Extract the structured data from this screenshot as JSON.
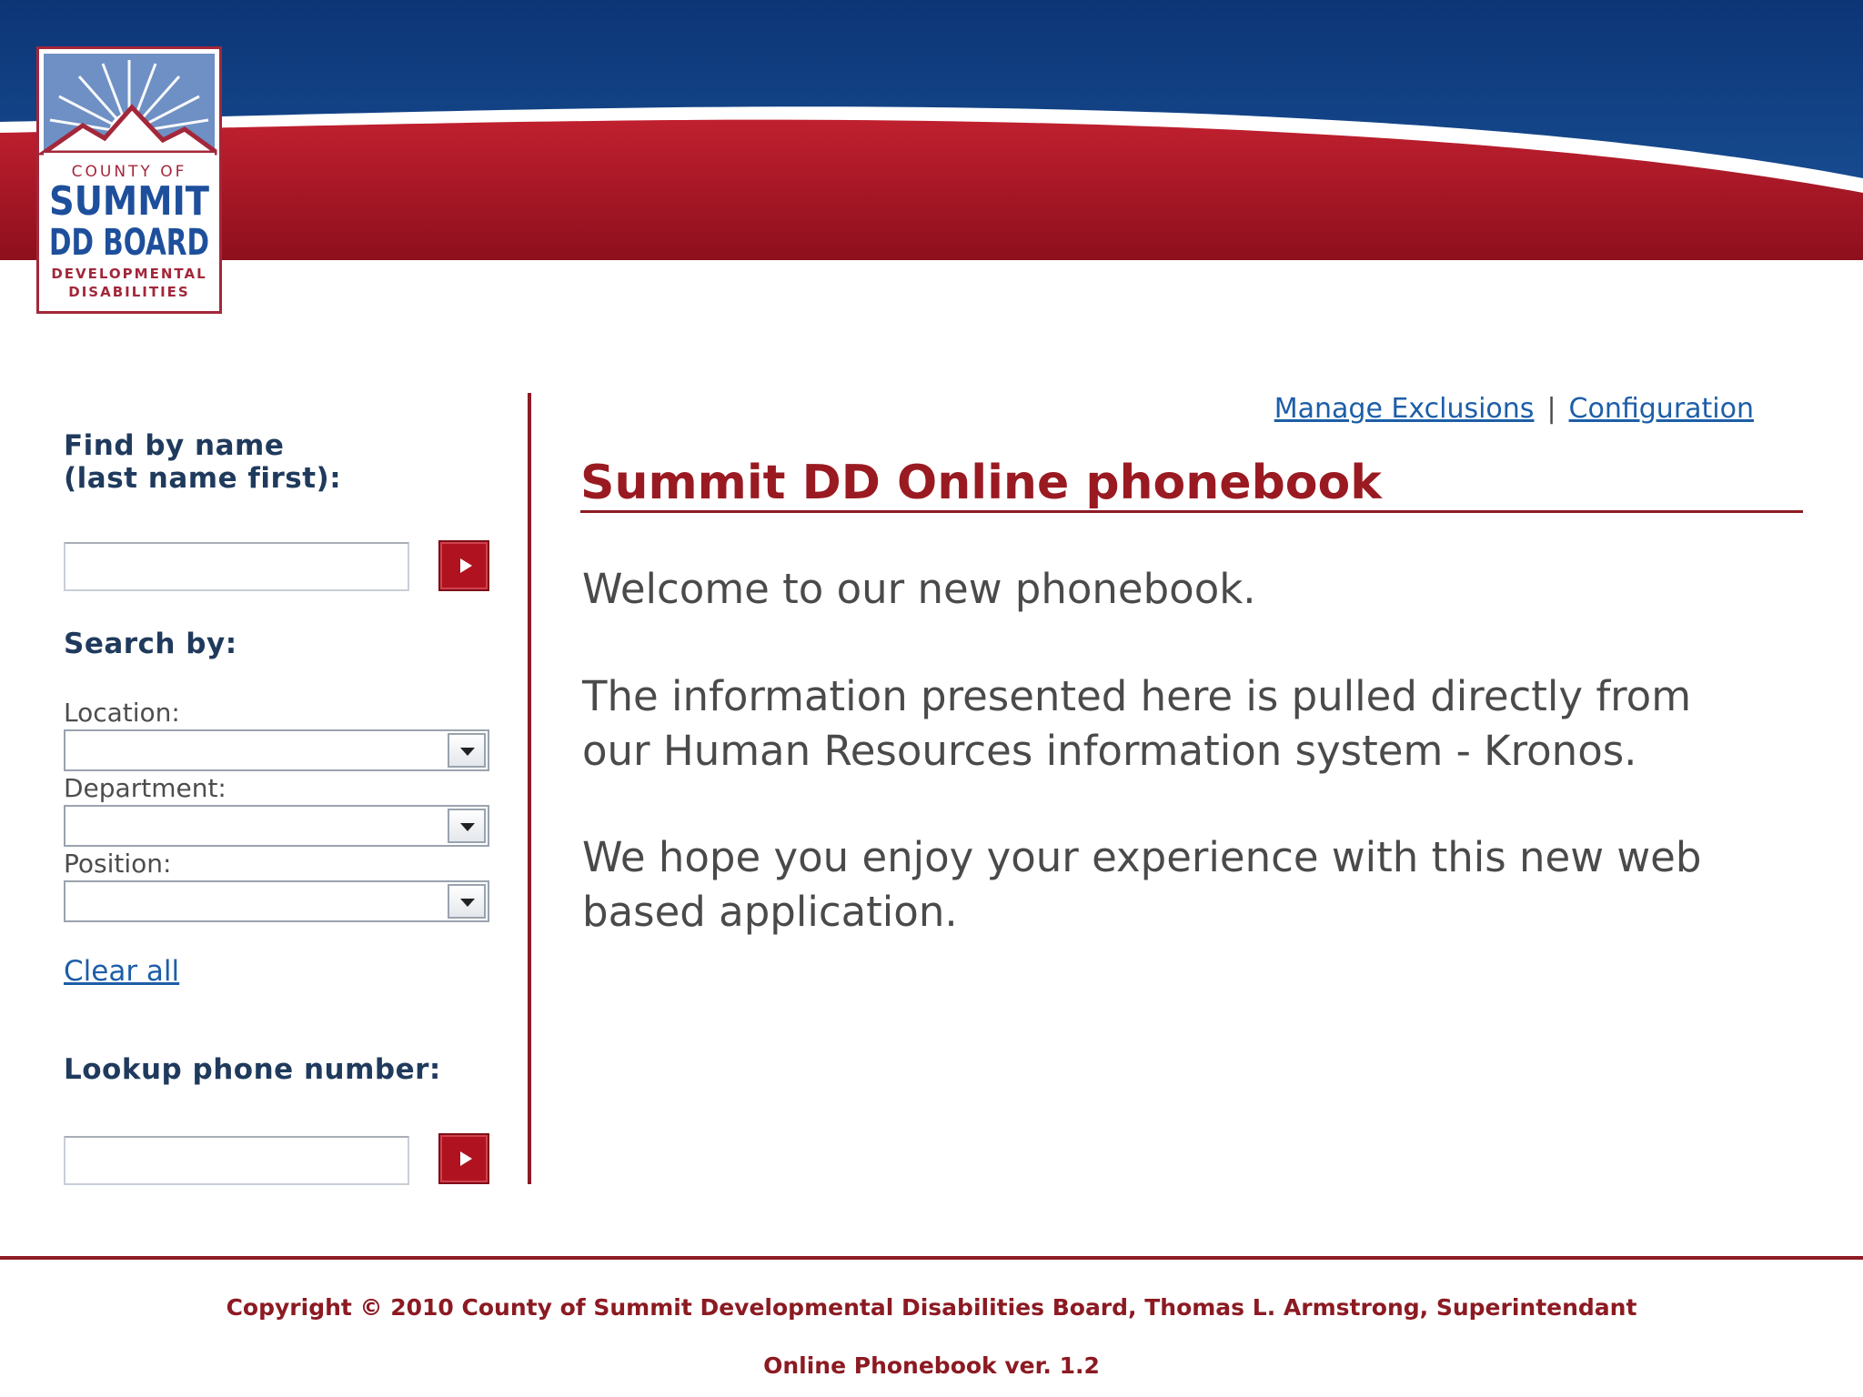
{
  "logo": {
    "line1": "COUNTY OF",
    "line2": "SUMMIT",
    "line3": "DD BOARD",
    "line4": "DEVELOPMENTAL",
    "line5": "DISABILITIES"
  },
  "sidebar": {
    "find_by_name_line1": "Find by name",
    "find_by_name_line2": "(last name first):",
    "name_input_value": "",
    "search_by_heading": "Search by:",
    "location_label": "Location:",
    "location_value": "",
    "department_label": "Department:",
    "department_value": "",
    "position_label": "Position:",
    "position_value": "",
    "clear_all_label": "Clear all",
    "lookup_phone_heading": "Lookup phone number:",
    "phone_input_value": ""
  },
  "header_links": {
    "manage_exclusions": "Manage Exclusions",
    "separator": "|",
    "configuration": "Configuration"
  },
  "main": {
    "title": "Summit DD Online phonebook",
    "paragraph1": "Welcome to our new phonebook.",
    "paragraph2_line1": "The information presented here is pulled directly from",
    "paragraph2_line2": "our Human Resources information system - Kronos.",
    "paragraph3_line1": "We hope you enjoy your experience with this new web",
    "paragraph3_line2": "based application."
  },
  "footer": {
    "copyright": "Copyright © 2010 County of Summit Developmental Disabilities Board, Thomas L. Armstrong, Superintendant",
    "version": "Online Phonebook ver. 1.2"
  },
  "colors": {
    "banner_blue": "#0f3b7c",
    "banner_red": "#a3182a",
    "accent_red": "#9a1a22",
    "link_blue": "#1d5ea8",
    "label_navy": "#1f3a5c"
  },
  "icons": {
    "go_button": "play-arrow-icon",
    "dropdown": "chevron-down-icon"
  }
}
